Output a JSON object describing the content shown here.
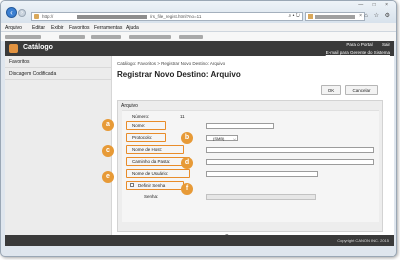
{
  "browser": {
    "url_prefix": "http://",
    "url_suffix": "/rs_file_regist.html?no=11",
    "url_controls": "⌕ • ↻",
    "tab_close": "×",
    "window_controls": "— □ ×",
    "toolbar_icons": "⌂ ☆ ⚙",
    "menu": [
      "Arquivo",
      "Editar",
      "Exibir",
      "Favoritos",
      "Ferramentas",
      "Ajuda"
    ]
  },
  "app": {
    "title": "Catálogo",
    "portal_link": "Para o Portal",
    "logout_link": "Sair",
    "admin_link": "E-mail para Gerente do Sistema"
  },
  "sidebar": {
    "items": [
      "Favoritos",
      "Discagem Codificada"
    ]
  },
  "main": {
    "breadcrumb": "Catálogo: Favoritos > Registrar Novo Destino: Arquivo",
    "title": "Registrar Novo Destino: Arquivo",
    "ok_label": "OK",
    "cancel_label": "Cancelar"
  },
  "form": {
    "section_title": "Arquivo",
    "number_label": "Número:",
    "number_value": "11",
    "name_label": "Nome:",
    "protocol_label": "Protocolo:",
    "protocol_value": "(SMB)",
    "host_label": "Nome de Host:",
    "path_label": "Caminho da Pasta:",
    "user_label": "Nome de Usuário:",
    "password_toggle_label": "Definir Senha",
    "password_label": "Senha:"
  },
  "callouts": [
    "a",
    "b",
    "c",
    "d",
    "e",
    "f"
  ],
  "footer": {
    "copyright": "Copyright CANON INC. 2015"
  },
  "colors": {
    "accent": "#e79a37",
    "header": "#3a3a3a",
    "link_blue": "#3b7fd1"
  }
}
